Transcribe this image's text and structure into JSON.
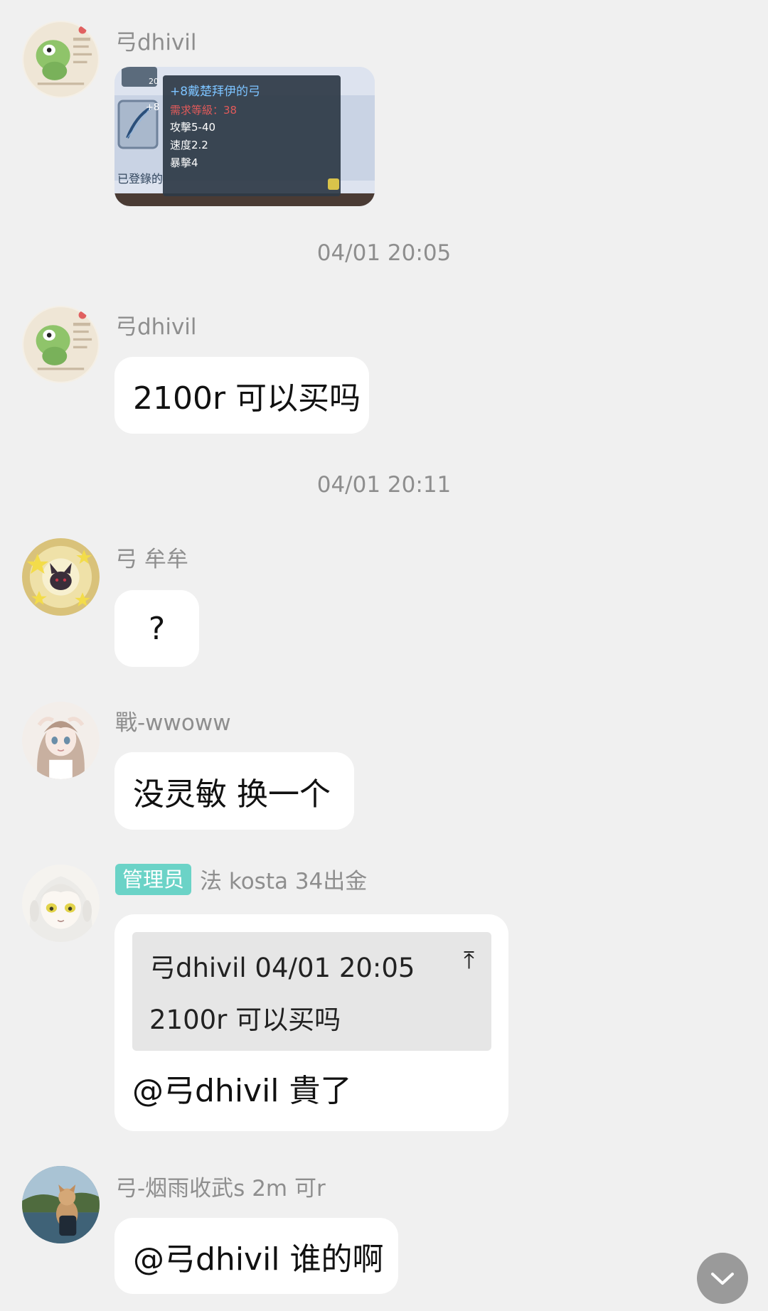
{
  "messages": {
    "m1": {
      "sender": "弓dhivil",
      "image": {
        "item_name": "+8戴楚拜伊的弓",
        "requirement_label": "需求等級：",
        "requirement_value": "38",
        "attack": "攻擊5-40",
        "speed": "速度2.2",
        "crit": "暴擊4",
        "registered": "已登錄的",
        "upgrade_badge": "+8",
        "side_count": "20"
      }
    },
    "t1": "04/01 20:05",
    "m2": {
      "sender": "弓dhivil",
      "text": "2100r 可以买吗"
    },
    "t2": "04/01 20:11",
    "m3": {
      "sender": "弓  牟牟",
      "text": "?"
    },
    "m4": {
      "sender": "戰-wwoww",
      "text": "没灵敏 换一个"
    },
    "m5": {
      "badge": "管理员",
      "sender": "法 kosta  34出金",
      "quote_header": "弓dhivil 04/01 20:05",
      "quote_up_icon": "⤒",
      "quote_text": "2100r 可以买吗",
      "reply": "@弓dhivil 貴了"
    },
    "m6": {
      "sender": "弓-烟雨收武s 2m 可r",
      "text": "@弓dhivil 谁的啊"
    }
  },
  "colors": {
    "background": "#f0f0f0",
    "bubble": "#ffffff",
    "admin_badge": "#6bd3c7",
    "meta_text": "#8e8e8e"
  },
  "icons": {
    "scroll_down": "chevron-down-icon"
  }
}
